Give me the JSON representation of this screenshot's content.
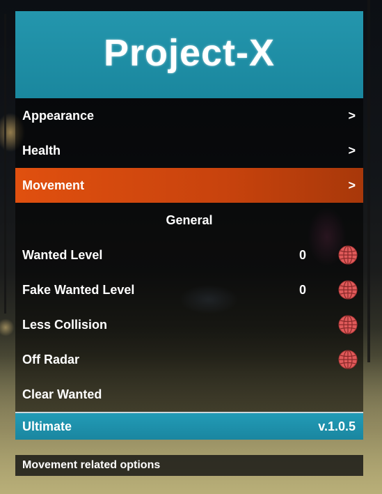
{
  "menu": {
    "title": "Project-X",
    "items": [
      {
        "label": "Appearance",
        "arrow": ">"
      },
      {
        "label": "Health",
        "arrow": ">"
      },
      {
        "label": "Movement",
        "arrow": ">",
        "selected": true
      }
    ],
    "section_header": "General",
    "options": [
      {
        "label": "Wanted Level",
        "value": "0",
        "toggle_icon": "globe-toggle-icon",
        "toggle_on": false
      },
      {
        "label": "Fake Wanted Level",
        "value": "0",
        "toggle_icon": "globe-toggle-icon",
        "toggle_on": false
      },
      {
        "label": "Less Collision",
        "toggle_icon": "globe-toggle-icon",
        "toggle_on": false
      },
      {
        "label": "Off Radar",
        "toggle_icon": "globe-toggle-icon",
        "toggle_on": false
      },
      {
        "label": "Clear Wanted"
      }
    ],
    "footer": {
      "left": "Ultimate",
      "right": "v.1.0.5"
    },
    "description": "Movement related options"
  },
  "colors": {
    "banner": "#1c8fa6",
    "selected": "#d84a0e",
    "footer": "#1f93ad",
    "toggle_off": "#e05a5a"
  }
}
